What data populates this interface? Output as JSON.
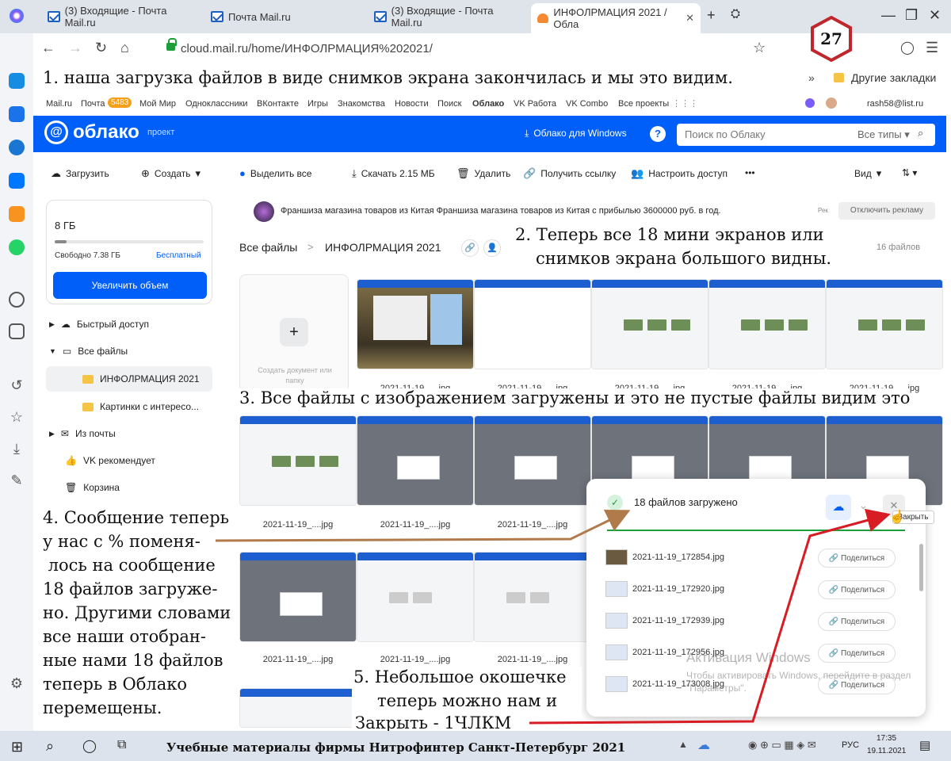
{
  "browser": {
    "tabs": [
      {
        "label": "(3) Входящие - Почта Mail.ru"
      },
      {
        "label": "Почта Mail.ru"
      },
      {
        "label": "(3) Входящие - Почта Mail.ru"
      },
      {
        "label": "ИНФОЛРМАЦИЯ 2021 / Обла"
      }
    ],
    "url": "cloud.mail.ru/home/ИНФОЛРМАЦИЯ%202021/",
    "bookmarks_label": "Другие закладки",
    "chevrons": "»"
  },
  "badge": "27",
  "annotations": {
    "a1": "1. наша загрузка файлов в виде снимков экрана закончилась и мы это видим.",
    "a2_l1": "2. Теперь все 18 мини экранов или",
    "a2_l2": "снимков экрана большого видны.",
    "a3": "3. Все файлы с изображением загружены и это не пустые файлы видим это",
    "a4": [
      "4. Сообщение теперь",
      "у нас с % поменя-",
      " лось на сообщение",
      "18 файлов загруже-",
      "но. Другими словами",
      "все наши отобран-",
      "ные нами 18 файлов",
      "теперь в Облако",
      "перемещены."
    ],
    "a5_l1": "5. Небольшое окошечке",
    "a5_l2": "теперь можно нам и",
    "a5_l3": "Закрыть - 1ЧЛКМ"
  },
  "mailbar": {
    "items": [
      "Mail.ru",
      "Почта",
      "Мой Мир",
      "Одноклассники",
      "ВКонтакте",
      "Игры",
      "Знакомства",
      "Новости",
      "Поиск",
      "Облако",
      "VK Работа",
      "VK Combo",
      "Все проекты"
    ],
    "mail_count": "5483",
    "user": "rash58@list.ru"
  },
  "header": {
    "logo": "облако",
    "project": "проект",
    "windows_btn": "Облако для Windows",
    "search_placeholder": "Поиск по Облаку",
    "types": "Все типы"
  },
  "toolbar": {
    "upload": "Загрузить",
    "create": "Создать",
    "select_all": "Выделить все",
    "download": "Скачать 2.15 МБ",
    "delete": "Удалить",
    "link": "Получить ссылку",
    "access": "Настроить доступ",
    "more": "•••",
    "view": "Вид"
  },
  "storage": {
    "total": "8 ГБ",
    "free": "Свободно 7.38 ГБ",
    "plan": "Бесплатный",
    "used_fraction": 0.08,
    "upgrade": "Увеличить объем"
  },
  "sidebar": {
    "items": [
      {
        "label": "Быстрый доступ"
      },
      {
        "label": "Все файлы"
      },
      {
        "label": "ИНФОЛРМАЦИЯ 2021"
      },
      {
        "label": "Картинки с интересо..."
      },
      {
        "label": "Из почты"
      },
      {
        "label": "VK рекомендует"
      },
      {
        "label": "Корзина"
      }
    ]
  },
  "ad": {
    "text": "Франшиза магазина товаров из Китая  Франшиза магазина товаров из Китая с прибылью 3600000 руб. в год.",
    "tag": "Рек",
    "disable": "Отключить рекламу"
  },
  "breadcrumb": {
    "root": "Все файлы",
    "sep": ">",
    "current": "ИНФОЛРМАЦИЯ 2021",
    "count": "16 файлов"
  },
  "create_doc": "Создать документ или папку",
  "captions": {
    "row1": "2021-11-19_....jpg",
    "row2": "2021-11-19_....jpg",
    "row3": "2021-11-19_....jpg"
  },
  "popup": {
    "title": "18 файлов загружено",
    "close_tip": "Закрыть",
    "share": "Поделиться",
    "files": [
      "2021-11-19_172854.jpg",
      "2021-11-19_172920.jpg",
      "2021-11-19_172939.jpg",
      "2021-11-19_172956.jpg",
      "2021-11-19_173008.jpg"
    ]
  },
  "watermark": {
    "title": "Активация Windows",
    "text": "Чтобы активировать Windows, перейдите в раздел \"Параметры\"."
  },
  "taskbar": {
    "center": "Учебные материалы фирмы Нитрофинтер  Санкт-Петербург  2021",
    "lang": "РУС",
    "time": "17:35",
    "date": "19.11.2021"
  }
}
